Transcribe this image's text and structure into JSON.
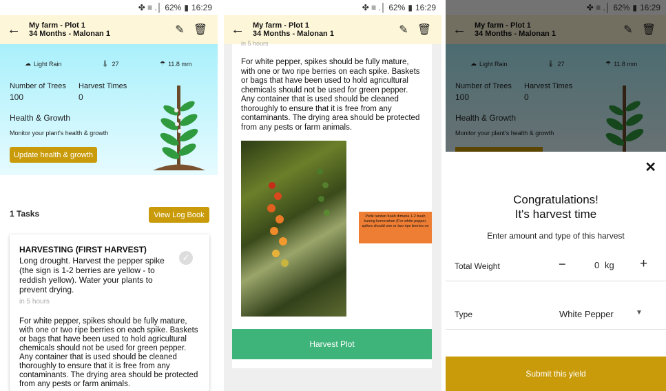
{
  "status": {
    "icons": "✤ ≡ .│",
    "battery": "62%",
    "time": "16:29"
  },
  "appbar": {
    "title": "My farm - Plot 1",
    "subtitle": "34 Months - Malonan 1"
  },
  "weather": {
    "condition": "Light Rain",
    "temp": "27",
    "rain": "11.8 mm"
  },
  "stats": {
    "trees_label": "Number of Trees",
    "trees_value": "100",
    "harvest_label": "Harvest Times",
    "harvest_value": "0"
  },
  "health": {
    "heading": "Health & Growth",
    "subtitle": "Monitor your plant's health & growth",
    "button": "Update health & growth"
  },
  "tasks": {
    "count": "1 Tasks",
    "logbook": "View Log Book"
  },
  "task": {
    "title": "HARVESTING (FIRST HARVEST)",
    "description": "Long drought. Harvest the pepper spike (the sign is 1-2 berries are yellow - to reddish yellow). Water your plants to prevent drying.",
    "when": "in 5 hours",
    "body": "For white pepper, spikes should be fully mature, with one or two ripe berries on each spike. Baskets or bags that have been used to hold agricultural chemicals should not be used for green pepper. Any container that is used should be cleaned thoroughly to ensure that it is free from any contaminants. The drying area should be protected from any pests or farm animals."
  },
  "detail": {
    "when": "in 5 hours",
    "callout": "Petik tandan buah dimana 1-2 buah kuning kemerahan (For white pepper, spikes should one or two ripe berries on",
    "button": "Harvest Plot"
  },
  "dialog": {
    "title1": "Congratulations!",
    "title2": "It's harvest time",
    "prompt": "Enter amount and type of this harvest",
    "weight_label": "Total Weight",
    "weight_value": "0",
    "unit": "kg",
    "type_label": "Type",
    "type_value": "White Pepper",
    "submit": "Submit this yield"
  },
  "colors": {
    "gold": "#c99b0b",
    "green": "#3fb47a",
    "appbar": "#fdf6d8"
  }
}
